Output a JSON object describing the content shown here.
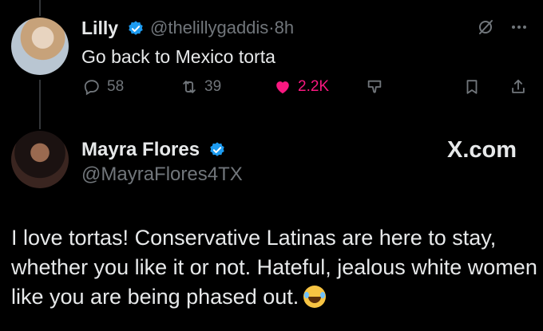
{
  "tweet_reply": {
    "name": "Lilly",
    "handle": "@thelillygaddis",
    "separator": "·",
    "time": "8h",
    "text": "Go back to Mexico torta",
    "stats": {
      "replies": "58",
      "reposts": "39",
      "likes": "2.2K"
    }
  },
  "tweet_quote": {
    "name": "Mayra Flores",
    "handle": "@MayraFlores4TX",
    "source": "X.com",
    "text": "I love tortas! Conservative Latinas are here to stay, whether you like it or not. Hateful, jealous white women like you are being phased out."
  },
  "colors": {
    "background": "#000000",
    "verified_badge": "#1d9bf0",
    "like_active": "#f91880",
    "muted": "#71767b"
  }
}
